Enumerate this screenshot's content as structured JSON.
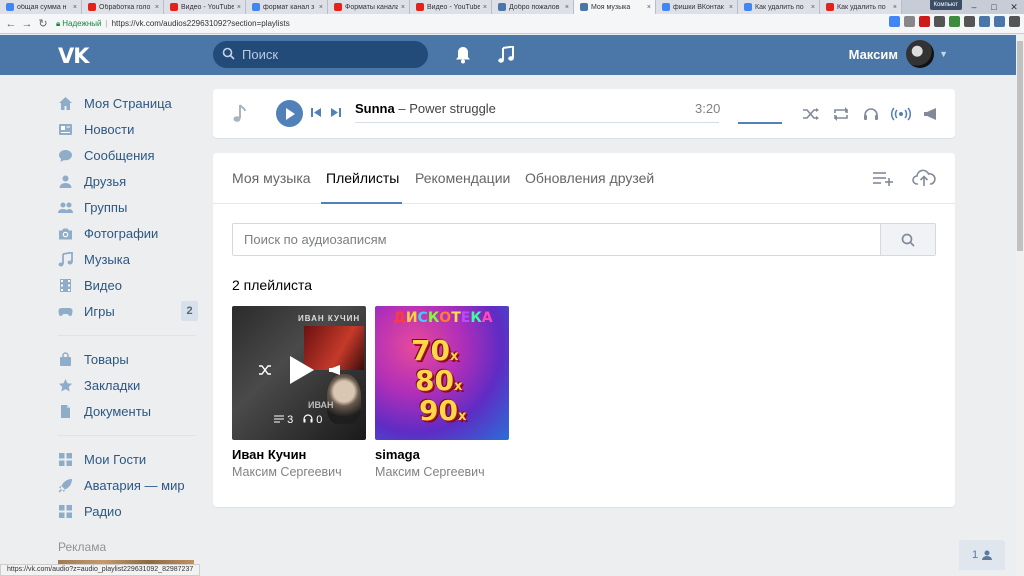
{
  "browser": {
    "tabs": [
      {
        "label": "общая сумма н",
        "color": "#4285f4"
      },
      {
        "label": "Обработка голо",
        "color": "#e62117"
      },
      {
        "label": "Видео - YouTube",
        "color": "#e62117"
      },
      {
        "label": "формат канал з",
        "color": "#4285f4"
      },
      {
        "label": "Форматы канала",
        "color": "#e62117"
      },
      {
        "label": "Видео - YouTube",
        "color": "#e62117"
      },
      {
        "label": "Добро пожалов",
        "color": "#4a76a8"
      },
      {
        "label": "Моя музыка",
        "color": "#4a76a8"
      },
      {
        "label": "фишки ВКонтак",
        "color": "#4285f4"
      },
      {
        "label": "Как удалить по",
        "color": "#4285f4"
      },
      {
        "label": "Как удалить по",
        "color": "#e62117"
      }
    ],
    "active_tab": 7,
    "user_badge": "Компьют",
    "secure_label": "Надежный",
    "url": "https://vk.com/audios229631092?section=playlists",
    "status_url": "https://vk.com/audio?z=audio_playlist229631092_82987237",
    "extensions": [
      {
        "icon": "translate-icon",
        "color": "#4285f4"
      },
      {
        "icon": "mail-icon",
        "color": "#888888"
      },
      {
        "icon": "opera-icon",
        "color": "#cc1b1b"
      },
      {
        "icon": "shield-icon",
        "color": "#555555"
      },
      {
        "icon": "badge-icon",
        "color": "#3d8c3d"
      },
      {
        "icon": "fx-icon",
        "color": "#555555"
      },
      {
        "icon": "iq-icon",
        "color": "#4a76a8"
      },
      {
        "icon": "bookmark-icon",
        "color": "#4a76a8"
      },
      {
        "icon": "menu-icon",
        "color": "#555555"
      }
    ]
  },
  "vk": {
    "logo": "VK",
    "search_placeholder": "Поиск",
    "user_name": "Максим"
  },
  "menu": {
    "items": [
      {
        "label": "Моя Страница",
        "icon": "home-icon"
      },
      {
        "label": "Новости",
        "icon": "news-icon"
      },
      {
        "label": "Сообщения",
        "icon": "messages-icon"
      },
      {
        "label": "Друзья",
        "icon": "friend-icon"
      },
      {
        "label": "Группы",
        "icon": "groups-icon"
      },
      {
        "label": "Фотографии",
        "icon": "camera-icon"
      },
      {
        "label": "Музыка",
        "icon": "music-icon"
      },
      {
        "label": "Видео",
        "icon": "video-icon"
      },
      {
        "label": "Игры",
        "icon": "gamepad-icon",
        "badge": "2"
      }
    ],
    "items2": [
      {
        "label": "Товары",
        "icon": "bag-icon"
      },
      {
        "label": "Закладки",
        "icon": "star-icon"
      },
      {
        "label": "Документы",
        "icon": "document-icon"
      }
    ],
    "items3": [
      {
        "label": "Мои Гости",
        "icon": "apps-icon"
      },
      {
        "label": "Аватария — мир",
        "icon": "rocket-icon"
      },
      {
        "label": "Радио",
        "icon": "apps-icon"
      }
    ],
    "ad_label": "Реклама"
  },
  "player": {
    "artist": "Sunna",
    "dash": " – ",
    "title": "Power struggle",
    "time": "3:20",
    "volume": 1.0
  },
  "music": {
    "tabs": [
      "Моя музыка",
      "Плейлисты",
      "Рекомендации",
      "Обновления друзей"
    ],
    "active_tab": 1,
    "search_placeholder": "Поиск по аудиозаписям",
    "count_label": "2 плейлиста",
    "playlists": [
      {
        "name": "Иван Кучин",
        "owner": "Максим Сергеевич",
        "cover_text_top": "ИВАН КУЧИН",
        "cover_text_bottom": "ИВАН",
        "tracks": "3",
        "listens": "0"
      },
      {
        "name": "simaga",
        "owner": "Максим Сергеевич",
        "cover_title": "ДИСКОТЕКА",
        "cover_years": [
          "70",
          "80",
          "90"
        ],
        "cover_suffix": "х"
      }
    ]
  },
  "friends": {
    "count": "1"
  }
}
